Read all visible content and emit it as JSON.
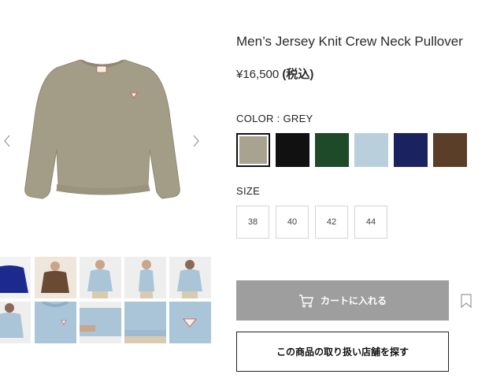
{
  "product": {
    "title": "Men’s Jersey Knit Crew Neck Pullover",
    "price": "¥16,500",
    "tax_label": "(税込)"
  },
  "colors": {
    "label": "COLOR : GREY",
    "options": [
      {
        "name": "grey",
        "hex": "#a8a290",
        "selected": true
      },
      {
        "name": "black",
        "hex": "#111111"
      },
      {
        "name": "green",
        "hex": "#1e4a2a"
      },
      {
        "name": "light-blue",
        "hex": "#b9cfdc"
      },
      {
        "name": "navy",
        "hex": "#1a2260"
      },
      {
        "name": "brown",
        "hex": "#5a3e28"
      }
    ]
  },
  "sizes": {
    "label": "SIZE",
    "options": [
      "38",
      "40",
      "42",
      "44"
    ]
  },
  "actions": {
    "cart_label": "カートに入れる",
    "store_label": "この商品の取り扱い店舗を探す"
  },
  "palette": {
    "main_sweater": "#a39d88",
    "cart_bg": "#9e9e9e"
  },
  "icons": {
    "prev": "chevron-left-icon",
    "next": "chevron-right-icon",
    "cart": "cart-icon",
    "bookmark": "bookmark-icon"
  }
}
